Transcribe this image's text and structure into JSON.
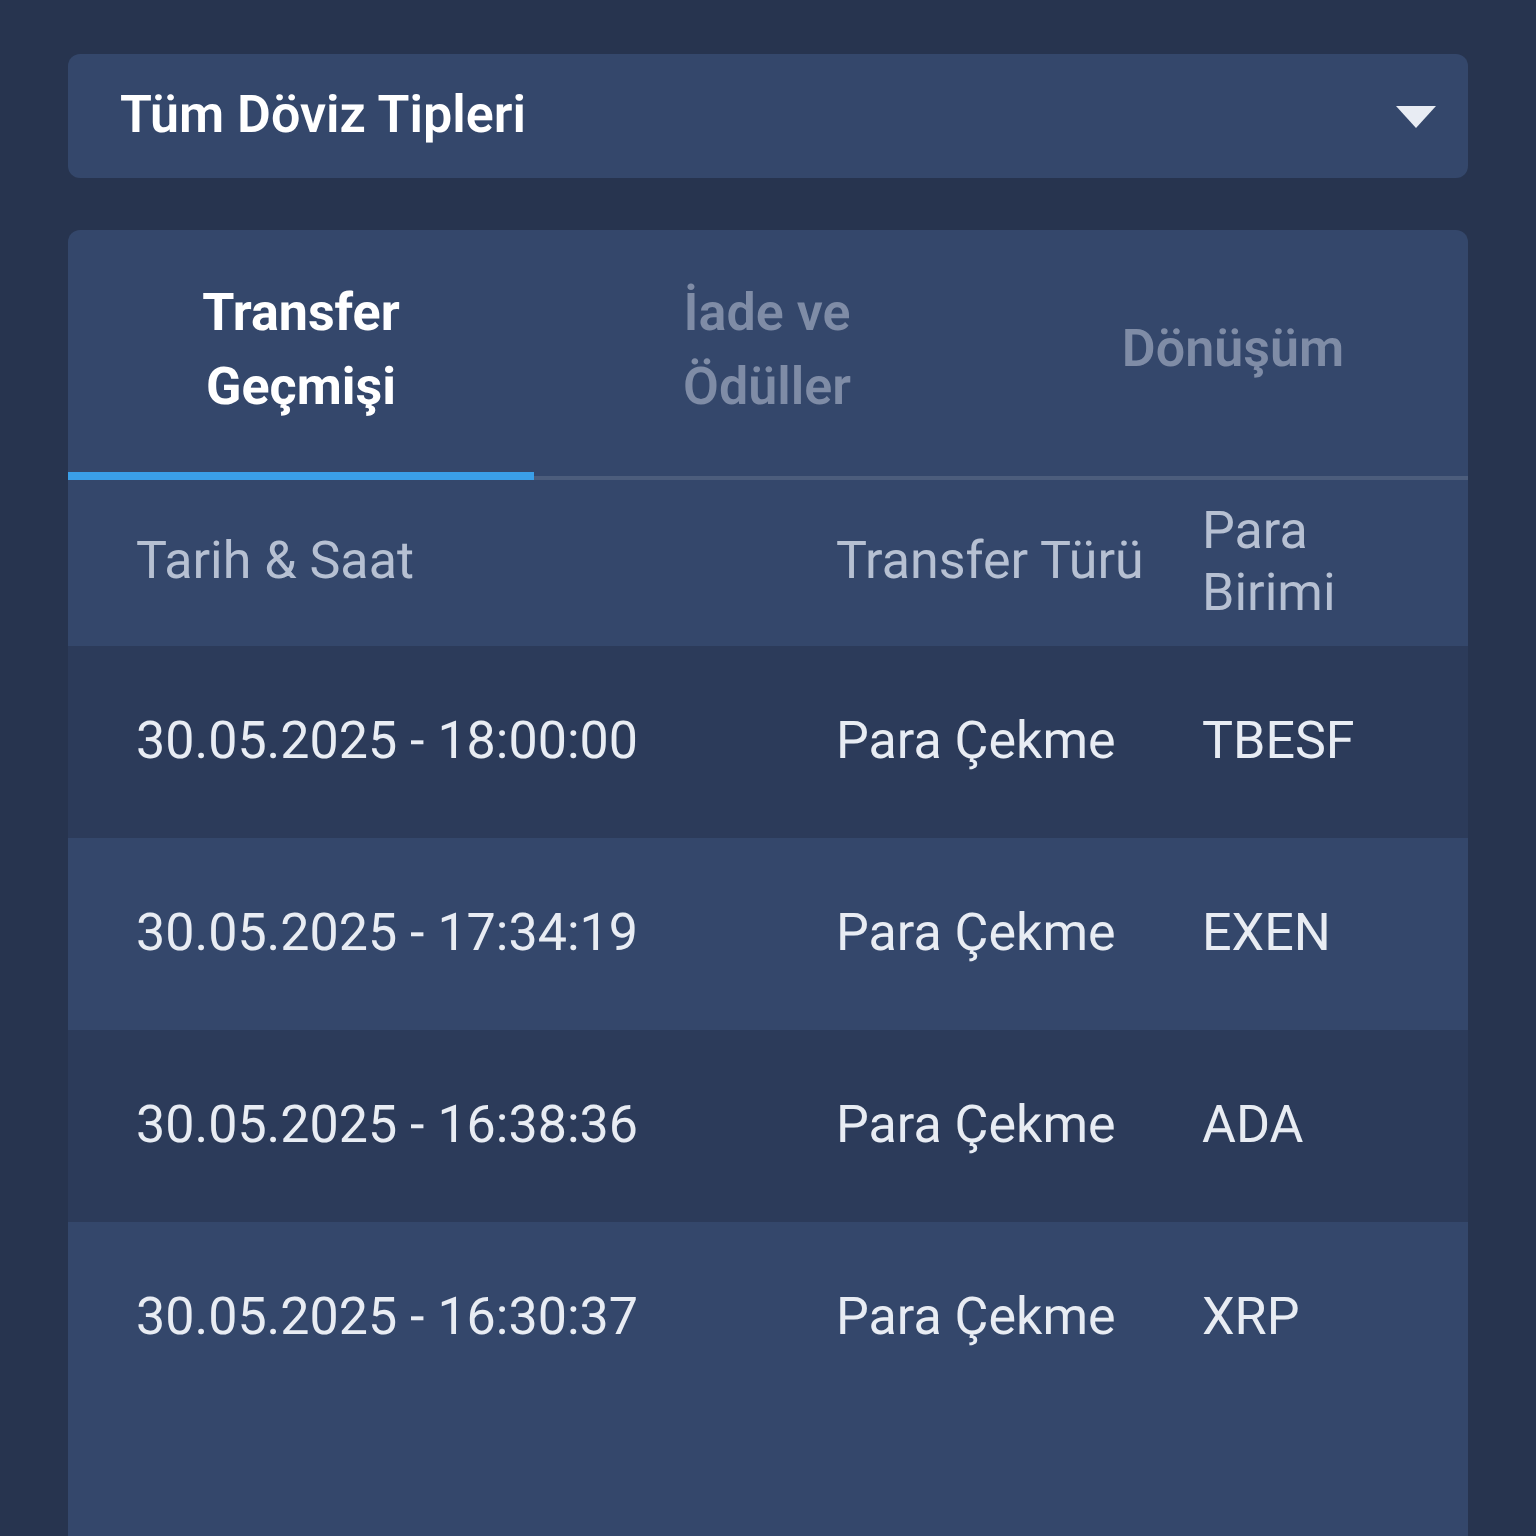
{
  "currency_filter": {
    "value": "Tüm Döviz Tipleri"
  },
  "tabs": [
    {
      "label": "Transfer Geçmişi",
      "selected": true
    },
    {
      "label": "İade ve Ödüller",
      "selected": false
    },
    {
      "label": "Dönüşüm",
      "selected": false
    }
  ],
  "table": {
    "columns": [
      "Tarih & Saat",
      "Transfer Türü",
      "Para Birimi"
    ],
    "rows": [
      [
        "30.05.2025 - 18:00:00",
        "Para Çekme",
        "TBESF"
      ],
      [
        "30.05.2025 - 17:34:19",
        "Para Çekme",
        "EXEN"
      ],
      [
        "30.05.2025 - 16:38:36",
        "Para Çekme",
        "ADA"
      ],
      [
        "30.05.2025 - 16:30:37",
        "Para Çekme",
        "XRP"
      ]
    ]
  }
}
